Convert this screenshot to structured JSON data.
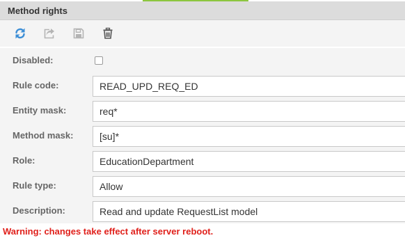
{
  "panel": {
    "title": "Method rights"
  },
  "toolbar": {
    "refresh_icon": "refresh-icon",
    "share_icon": "share-icon",
    "save_icon": "save-icon",
    "delete_icon": "trash-icon"
  },
  "form": {
    "disabled": {
      "label": "Disabled:",
      "checked": false
    },
    "rule_code": {
      "label": "Rule code:",
      "value": "READ_UPD_REQ_ED"
    },
    "entity_mask": {
      "label": "Entity mask:",
      "value": "req*"
    },
    "method_mask": {
      "label": "Method mask:",
      "value": "[su]*"
    },
    "role": {
      "label": "Role:",
      "value": "EducationDepartment"
    },
    "rule_type": {
      "label": "Rule type:",
      "value": "Allow"
    },
    "description": {
      "label": "Description:",
      "value": "Read and update RequestList model"
    }
  },
  "warning": {
    "text": "Warning: changes take effect after server reboot."
  },
  "colors": {
    "accent_blue": "#3c8ed6",
    "disabled_gray": "#b4b4b4",
    "warning_red": "#e0201b",
    "header_bg": "#dcdcdc",
    "top_accent_green": "#8cc63f"
  }
}
